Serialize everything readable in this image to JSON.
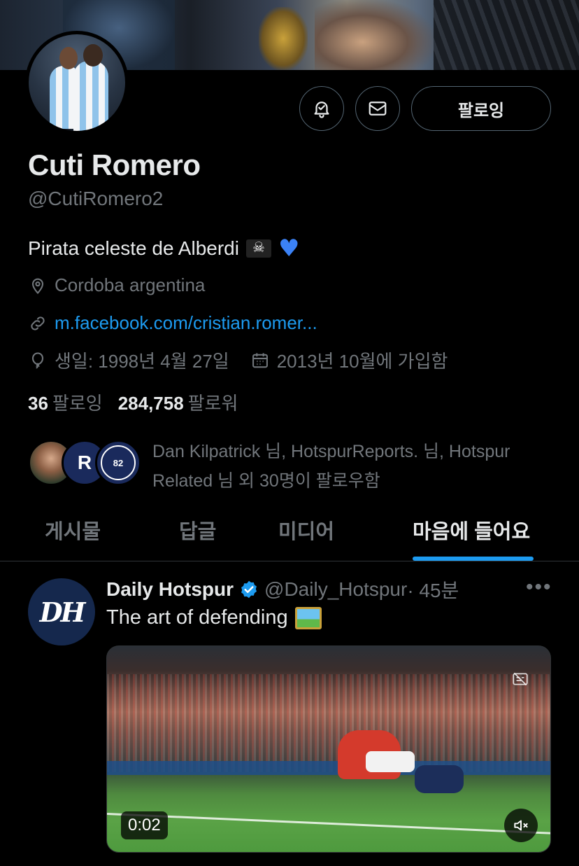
{
  "profile": {
    "name": "Cuti Romero",
    "handle": "@CutiRomero2",
    "bio_text": "Pirata celeste de Alberdi",
    "location": "Cordoba argentina",
    "website": "m.facebook.com/cristian.romer...",
    "birthday": "생일: 1998년 4월 27일",
    "joined": "2013년 10월에 가입함",
    "following_count": "36",
    "following_label": "팔로잉",
    "followers_count": "284,758",
    "followers_label": "팔로워",
    "known_followers": "Dan Kilpatrick 님, HotspurReports. 님, Hotspur Related 님 외 30명이 팔로우함"
  },
  "actions": {
    "follow_button_label": "팔로잉"
  },
  "tabs": [
    {
      "label": "게시물",
      "active": false
    },
    {
      "label": "답글",
      "active": false
    },
    {
      "label": "미디어",
      "active": false
    },
    {
      "label": "마음에 들어요",
      "active": true
    }
  ],
  "post": {
    "author": "Daily Hotspur",
    "handle": "@Daily_Hotspur",
    "time": "· 45분",
    "text": "The art of defending",
    "video_time": "0:02",
    "avatar_text": "DH",
    "more": "•••"
  },
  "colors": {
    "accent": "#1d9bf0",
    "background": "#000000",
    "muted_text": "#71767b"
  }
}
